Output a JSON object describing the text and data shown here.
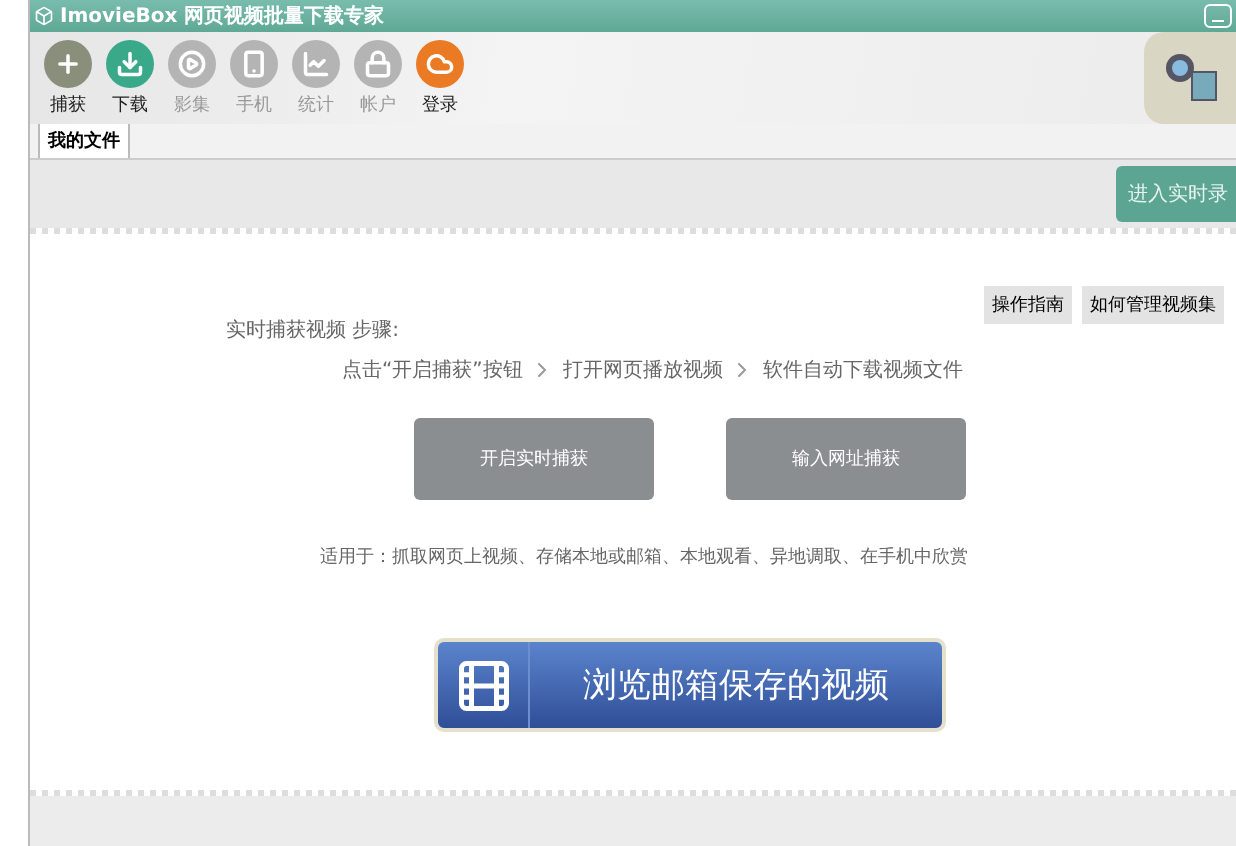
{
  "window": {
    "title": "ImovieBox 网页视频批量下载专家"
  },
  "toolbar": [
    {
      "kind": "capture",
      "label": "捕获",
      "disabled": false,
      "color": "#8a8f7c"
    },
    {
      "kind": "download",
      "label": "下载",
      "disabled": false,
      "color": "#3aa98a"
    },
    {
      "kind": "album",
      "label": "影集",
      "disabled": true,
      "color": "#b4b4b4"
    },
    {
      "kind": "phone",
      "label": "手机",
      "disabled": true,
      "color": "#b4b4b4"
    },
    {
      "kind": "stats",
      "label": "统计",
      "disabled": true,
      "color": "#b4b4b4"
    },
    {
      "kind": "account",
      "label": "帐户",
      "disabled": true,
      "color": "#b4b4b4"
    },
    {
      "kind": "login",
      "label": "登录",
      "disabled": false,
      "color": "#ea7a24"
    }
  ],
  "tabs": [
    {
      "label": "我的文件",
      "selected": true
    }
  ],
  "record_button": "进入实时录",
  "help_buttons": [
    "操作指南",
    "如何管理视频集"
  ],
  "steps_title": "实时捕获视频 步骤:",
  "steps": [
    "点击“开启捕获”按钮",
    "打开网页播放视频",
    "软件自动下载视频文件"
  ],
  "capture_buttons": [
    "开启实时捕获",
    "输入网址捕获"
  ],
  "usage": "适用于：抓取网页上视频、存储本地或邮箱、本地观看、异地调取、在手机中欣赏",
  "browse_button": "浏览邮箱保存的视频"
}
